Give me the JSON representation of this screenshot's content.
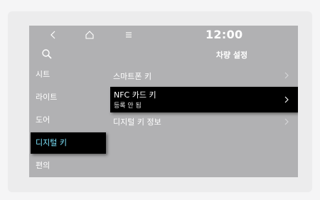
{
  "status_bar": {
    "clock": "12:00",
    "icons": [
      "back-icon",
      "home-icon",
      "menu-icon",
      "search-icon"
    ]
  },
  "header": {
    "title": "차량 설정"
  },
  "sidebar": {
    "items": [
      {
        "label": "시트"
      },
      {
        "label": "라이트"
      },
      {
        "label": "도어"
      },
      {
        "label": "디지털 키",
        "active": true
      },
      {
        "label": "편의"
      }
    ]
  },
  "list": {
    "items": [
      {
        "label": "스마트폰 키"
      },
      {
        "label": "NFC 카드 키",
        "sub": "등록 안 됨",
        "selected": true
      },
      {
        "label": "디지털 키 정보"
      }
    ]
  },
  "colors": {
    "screen_bg": "#b1b1b3",
    "highlight_bg": "#000000",
    "active_text": "#7ee6ff",
    "text": "#ffffff"
  }
}
